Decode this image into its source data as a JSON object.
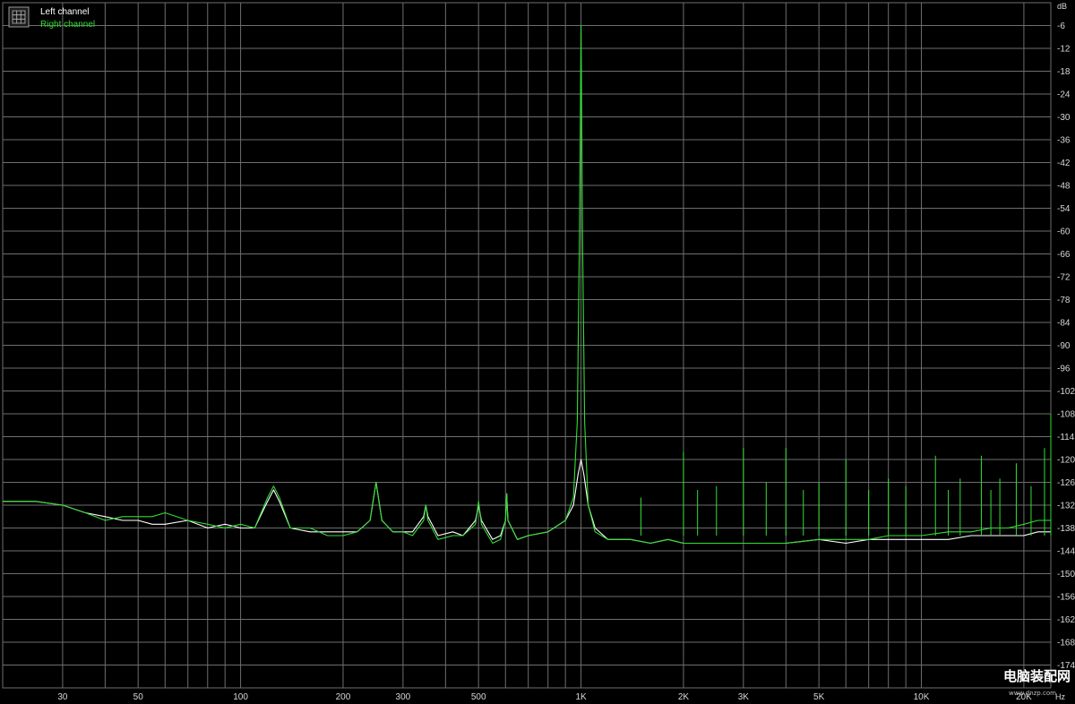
{
  "legend": {
    "left_label": "Left channel",
    "right_label": "Right channel",
    "icon": "grid-icon"
  },
  "colors": {
    "background": "#000000",
    "grid": "#6e6e6e",
    "left": "#ffffff",
    "right": "#33dd33",
    "label": "#d8d8d8"
  },
  "watermark": {
    "text": "电脑装配网",
    "url_text": "www.dnzp.com"
  },
  "chart_data": {
    "type": "line",
    "title": "",
    "xlabel": "Hz",
    "ylabel": "dB",
    "x_scale": "log",
    "xlim": [
      20,
      24000
    ],
    "ylim": [
      -180,
      0
    ],
    "grid": true,
    "legend_position": "top-left",
    "x_ticks": [
      {
        "value": 30,
        "label": "30"
      },
      {
        "value": 50,
        "label": "50"
      },
      {
        "value": 100,
        "label": "100"
      },
      {
        "value": 200,
        "label": "200"
      },
      {
        "value": 300,
        "label": "300"
      },
      {
        "value": 500,
        "label": "500"
      },
      {
        "value": 1000,
        "label": "1K"
      },
      {
        "value": 2000,
        "label": "2K"
      },
      {
        "value": 3000,
        "label": "3K"
      },
      {
        "value": 5000,
        "label": "5K"
      },
      {
        "value": 10000,
        "label": "10K"
      },
      {
        "value": 20000,
        "label": "20K"
      }
    ],
    "y_ticks": [
      {
        "value": -6,
        "label": "-6"
      },
      {
        "value": -12,
        "label": "-12"
      },
      {
        "value": -18,
        "label": "-18"
      },
      {
        "value": -24,
        "label": "-24"
      },
      {
        "value": -30,
        "label": "-30"
      },
      {
        "value": -36,
        "label": "-36"
      },
      {
        "value": -42,
        "label": "-42"
      },
      {
        "value": -48,
        "label": "-48"
      },
      {
        "value": -54,
        "label": "-54"
      },
      {
        "value": -60,
        "label": "-60"
      },
      {
        "value": -66,
        "label": "-66"
      },
      {
        "value": -72,
        "label": "-72"
      },
      {
        "value": -78,
        "label": "-78"
      },
      {
        "value": -84,
        "label": "-84"
      },
      {
        "value": -90,
        "label": "-90"
      },
      {
        "value": -96,
        "label": "-96"
      },
      {
        "value": -102,
        "label": "-102"
      },
      {
        "value": -108,
        "label": "-108"
      },
      {
        "value": -114,
        "label": "-114"
      },
      {
        "value": -120,
        "label": "-120"
      },
      {
        "value": -126,
        "label": "-126"
      },
      {
        "value": -132,
        "label": "-132"
      },
      {
        "value": -138,
        "label": "-138"
      },
      {
        "value": -144,
        "label": "-144"
      },
      {
        "value": -150,
        "label": "-150"
      },
      {
        "value": -156,
        "label": "-156"
      },
      {
        "value": -162,
        "label": "-162"
      },
      {
        "value": -168,
        "label": "-168"
      },
      {
        "value": -174,
        "label": "-174"
      }
    ],
    "series": [
      {
        "name": "Left channel",
        "color": "#ffffff",
        "points": [
          [
            20,
            -131
          ],
          [
            25,
            -131
          ],
          [
            30,
            -132
          ],
          [
            35,
            -134
          ],
          [
            40,
            -135
          ],
          [
            45,
            -136
          ],
          [
            50,
            -136
          ],
          [
            55,
            -137
          ],
          [
            60,
            -137
          ],
          [
            70,
            -136
          ],
          [
            80,
            -138
          ],
          [
            90,
            -137
          ],
          [
            100,
            -138
          ],
          [
            110,
            -138
          ],
          [
            120,
            -131
          ],
          [
            125,
            -128
          ],
          [
            130,
            -131
          ],
          [
            140,
            -138
          ],
          [
            160,
            -139
          ],
          [
            180,
            -139
          ],
          [
            200,
            -139
          ],
          [
            220,
            -139
          ],
          [
            240,
            -136
          ],
          [
            250,
            -126
          ],
          [
            260,
            -136
          ],
          [
            280,
            -139
          ],
          [
            300,
            -139
          ],
          [
            320,
            -139
          ],
          [
            345,
            -135
          ],
          [
            350,
            -132
          ],
          [
            355,
            -135
          ],
          [
            380,
            -140
          ],
          [
            420,
            -139
          ],
          [
            450,
            -140
          ],
          [
            490,
            -136
          ],
          [
            500,
            -132
          ],
          [
            510,
            -136
          ],
          [
            550,
            -141
          ],
          [
            580,
            -140
          ],
          [
            600,
            -136
          ],
          [
            605,
            -129
          ],
          [
            610,
            -136
          ],
          [
            650,
            -141
          ],
          [
            700,
            -140
          ],
          [
            800,
            -139
          ],
          [
            900,
            -136
          ],
          [
            950,
            -132
          ],
          [
            980,
            -124
          ],
          [
            1000,
            -120
          ],
          [
            1020,
            -124
          ],
          [
            1050,
            -132
          ],
          [
            1100,
            -138
          ],
          [
            1200,
            -141
          ],
          [
            1400,
            -141
          ],
          [
            1600,
            -142
          ],
          [
            1800,
            -141
          ],
          [
            2000,
            -142
          ],
          [
            2500,
            -142
          ],
          [
            3000,
            -142
          ],
          [
            3500,
            -142
          ],
          [
            4000,
            -142
          ],
          [
            5000,
            -141
          ],
          [
            6000,
            -142
          ],
          [
            7000,
            -141
          ],
          [
            8000,
            -141
          ],
          [
            10000,
            -141
          ],
          [
            12000,
            -141
          ],
          [
            14000,
            -140
          ],
          [
            16000,
            -140
          ],
          [
            18000,
            -140
          ],
          [
            20000,
            -140
          ],
          [
            22000,
            -139
          ],
          [
            24000,
            -139
          ]
        ]
      },
      {
        "name": "Right channel",
        "color": "#33dd33",
        "points": [
          [
            20,
            -131
          ],
          [
            25,
            -131
          ],
          [
            30,
            -132
          ],
          [
            35,
            -134
          ],
          [
            40,
            -136
          ],
          [
            45,
            -135
          ],
          [
            50,
            -135
          ],
          [
            55,
            -135
          ],
          [
            60,
            -134
          ],
          [
            70,
            -136
          ],
          [
            80,
            -137
          ],
          [
            90,
            -138
          ],
          [
            100,
            -137
          ],
          [
            110,
            -138
          ],
          [
            120,
            -130
          ],
          [
            125,
            -127
          ],
          [
            130,
            -130
          ],
          [
            140,
            -138
          ],
          [
            160,
            -138
          ],
          [
            180,
            -140
          ],
          [
            200,
            -140
          ],
          [
            220,
            -139
          ],
          [
            240,
            -136
          ],
          [
            250,
            -126
          ],
          [
            260,
            -136
          ],
          [
            280,
            -139
          ],
          [
            300,
            -139
          ],
          [
            320,
            -140
          ],
          [
            345,
            -136
          ],
          [
            350,
            -132
          ],
          [
            355,
            -136
          ],
          [
            380,
            -141
          ],
          [
            420,
            -140
          ],
          [
            450,
            -140
          ],
          [
            490,
            -137
          ],
          [
            500,
            -131
          ],
          [
            510,
            -137
          ],
          [
            550,
            -142
          ],
          [
            580,
            -141
          ],
          [
            600,
            -136
          ],
          [
            605,
            -129
          ],
          [
            610,
            -136
          ],
          [
            650,
            -141
          ],
          [
            700,
            -140
          ],
          [
            800,
            -139
          ],
          [
            900,
            -136
          ],
          [
            950,
            -130
          ],
          [
            975,
            -110
          ],
          [
            990,
            -60
          ],
          [
            1000,
            -6
          ],
          [
            1010,
            -60
          ],
          [
            1025,
            -110
          ],
          [
            1050,
            -132
          ],
          [
            1100,
            -139
          ],
          [
            1200,
            -141
          ],
          [
            1400,
            -141
          ],
          [
            1600,
            -142
          ],
          [
            1800,
            -141
          ],
          [
            2000,
            -142
          ],
          [
            2500,
            -142
          ],
          [
            3000,
            -142
          ],
          [
            3500,
            -142
          ],
          [
            4000,
            -142
          ],
          [
            5000,
            -141
          ],
          [
            6000,
            -141
          ],
          [
            7000,
            -141
          ],
          [
            8000,
            -140
          ],
          [
            10000,
            -140
          ],
          [
            12000,
            -139
          ],
          [
            14000,
            -139
          ],
          [
            16000,
            -138
          ],
          [
            18000,
            -138
          ],
          [
            20000,
            -137
          ],
          [
            22000,
            -136
          ],
          [
            24000,
            -136
          ]
        ]
      }
    ],
    "harmonics_right": [
      [
        1500,
        -130
      ],
      [
        2000,
        -118
      ],
      [
        2200,
        -128
      ],
      [
        2500,
        -127
      ],
      [
        3000,
        -117
      ],
      [
        3500,
        -126
      ],
      [
        4000,
        -117
      ],
      [
        4500,
        -128
      ],
      [
        5000,
        -126
      ],
      [
        6000,
        -120
      ],
      [
        7000,
        -128
      ],
      [
        8000,
        -125
      ],
      [
        9000,
        -127
      ],
      [
        11000,
        -119
      ],
      [
        12000,
        -128
      ],
      [
        13000,
        -125
      ],
      [
        15000,
        -119
      ],
      [
        16000,
        -128
      ],
      [
        17000,
        -125
      ],
      [
        19000,
        -121
      ],
      [
        21000,
        -127
      ],
      [
        23000,
        -117
      ],
      [
        24000,
        -108
      ]
    ]
  }
}
